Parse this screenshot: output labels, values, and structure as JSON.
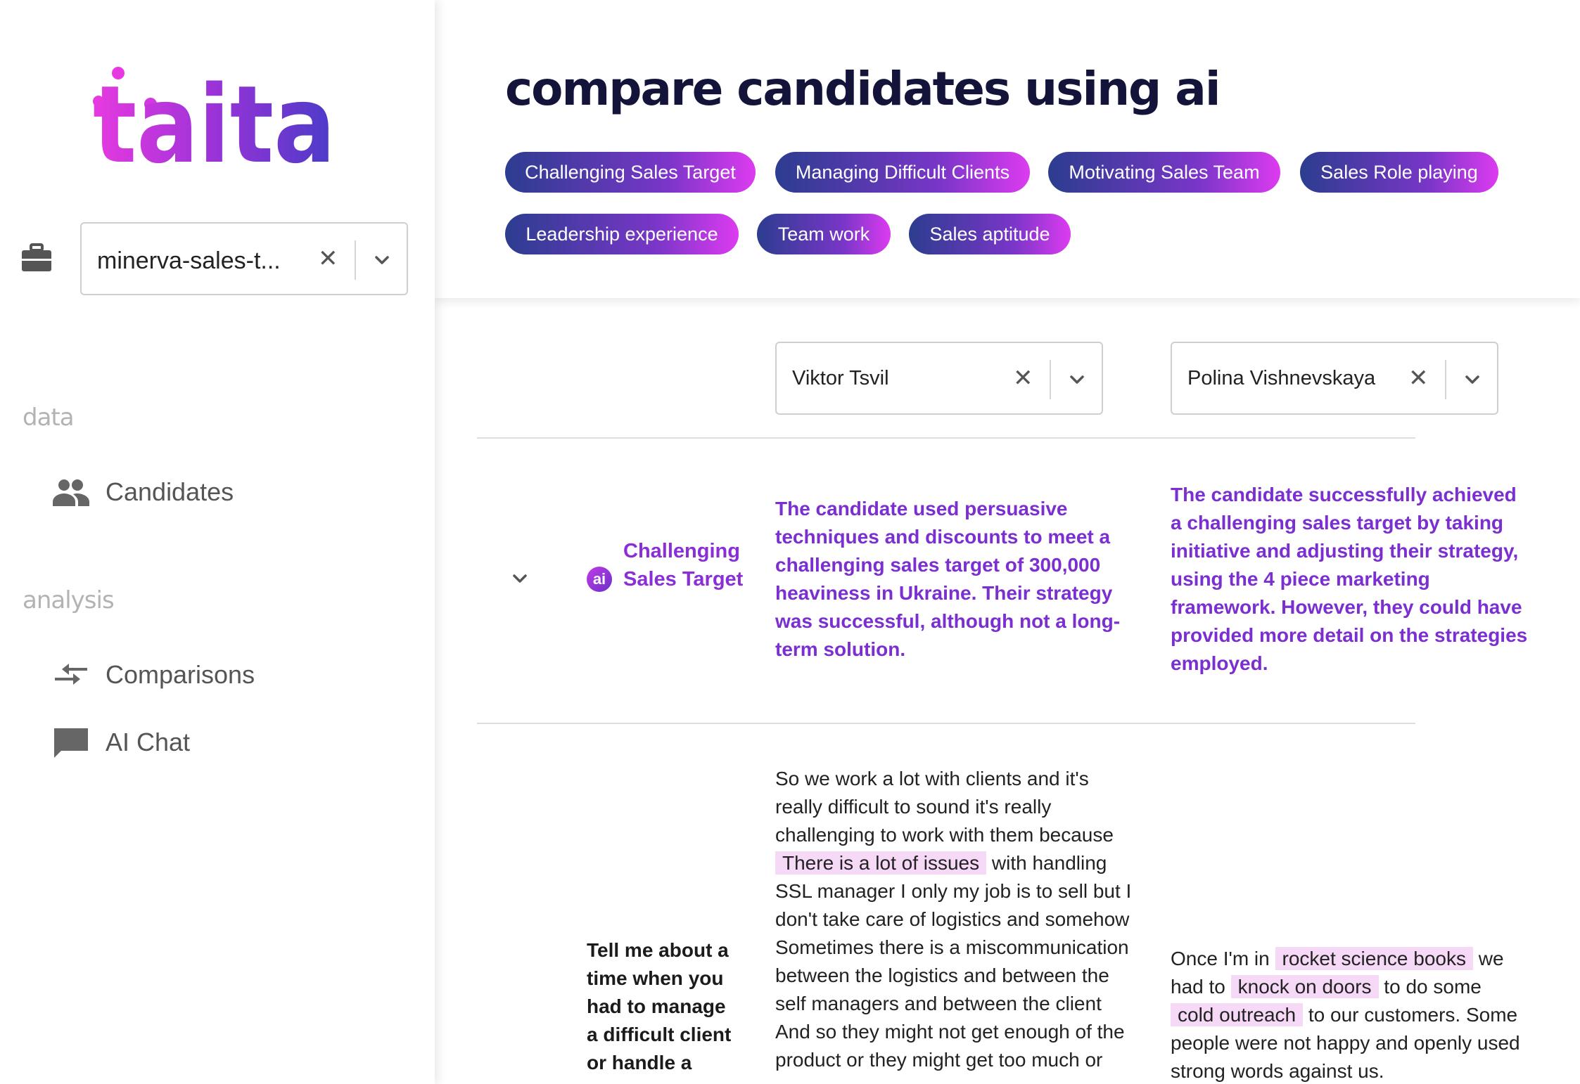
{
  "brand": {
    "logo_text": "taita"
  },
  "sidebar": {
    "project_select": {
      "value": "minerva-sales-t...",
      "clear_symbol": "✕"
    },
    "sections": [
      {
        "label": "data",
        "items": [
          {
            "label": "Candidates",
            "icon": "people-icon"
          }
        ]
      },
      {
        "label": "analysis",
        "items": [
          {
            "label": "Comparisons",
            "icon": "compare-arrows-icon"
          },
          {
            "label": "AI Chat",
            "icon": "chat-icon"
          }
        ]
      }
    ]
  },
  "header": {
    "title": "compare candidates using ai",
    "chips": [
      "Challenging Sales Target",
      "Managing Difficult Clients",
      "Motivating Sales Team",
      "Sales Role playing",
      "Leadership experience",
      "Team work",
      "Sales aptitude"
    ]
  },
  "comparison": {
    "candidates": [
      {
        "name": "Viktor Tsvil",
        "clear_symbol": "✕"
      },
      {
        "name": "Polina Vishnevskaya",
        "clear_symbol": "✕"
      }
    ],
    "rows": [
      {
        "badge": "ai",
        "criterion": "Challenging Sales Target",
        "summaries": [
          "The candidate used persuasive techniques and discounts to meet a challenging sales target of 300,000 heaviness in Ukraine. Their strategy was successful, although not a long-term solution.",
          "The candidate successfully achieved a challenging sales target by taking initiative and adjusting their strategy, using the 4 piece marketing framework. However, they could have provided more detail on the strategies employed."
        ]
      }
    ],
    "question_row": {
      "question": "Tell me about a time when you had to manage a difficult client or handle a customer",
      "answers": [
        {
          "before": "So we work a lot with clients and it's really difficult to sound it's really challenging to work with them because ",
          "highlight": "There is a lot of issues",
          "after": " with handling SSL manager I only my job is to sell but I don't take care of logistics and somehow Sometimes there is a miscommunication between the logistics and between the self managers and between the client And so they might not get enough of the product or they might get too much or"
        },
        {
          "t1": "Once I'm in ",
          "h1": "rocket science books",
          "t2": " we had to ",
          "h2": "knock on doors",
          "t3": " to do some ",
          "h3": "cold outreach",
          "t4": " to our customers. Some people were not happy and openly used strong words against us."
        }
      ]
    }
  },
  "colors": {
    "accent_purple": "#7b2fd0",
    "chip_start": "#2c3d8f",
    "chip_end": "#dd3bf0",
    "highlight": "#f6d9f7"
  }
}
